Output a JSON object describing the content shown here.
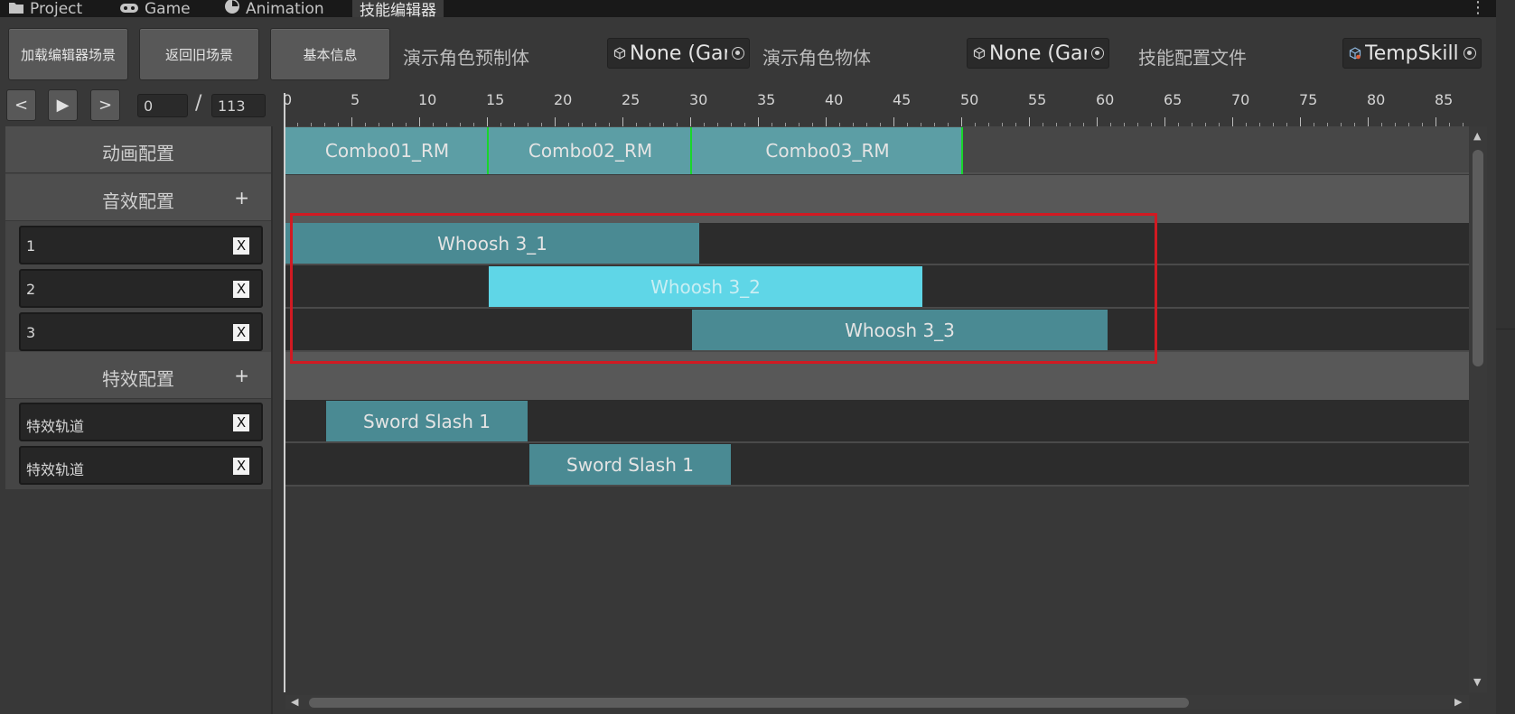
{
  "tabs": [
    {
      "label": "Project",
      "icon": "folder-icon"
    },
    {
      "label": "Game",
      "icon": "gamepad-icon"
    },
    {
      "label": "Animation",
      "icon": "clock-icon"
    },
    {
      "label": "技能编辑器",
      "active": true
    }
  ],
  "toolbar": {
    "load_scene_label": "加载编辑器场景",
    "back_scene_label": "返回旧场景",
    "basic_info_label": "基本信息",
    "preview_prefab_label": "演示角色预制体",
    "preview_prefab_value": "None (Gar",
    "preview_object_label": "演示角色物体",
    "preview_object_value": "None (Gar",
    "skill_config_label": "技能配置文件",
    "skill_config_value": "TempSkill"
  },
  "playback": {
    "prev_label": "<",
    "play_label": "▶",
    "next_label": ">",
    "current_frame": "0",
    "separator": "/",
    "total_frames": "113"
  },
  "ruler": {
    "labels": [
      "0",
      "5",
      "10",
      "15",
      "20",
      "25",
      "30",
      "35",
      "40",
      "45",
      "50",
      "55",
      "60",
      "65",
      "70",
      "75",
      "80",
      "85"
    ]
  },
  "left_panel": {
    "animation_header": "动画配置",
    "audio_header": "音效配置",
    "audio_add": "+",
    "audio_tracks": [
      {
        "name": "1",
        "remove": "X"
      },
      {
        "name": "2",
        "remove": "X"
      },
      {
        "name": "3",
        "remove": "X"
      }
    ],
    "effect_header": "特效配置",
    "effect_add": "+",
    "effect_tracks": [
      {
        "name": "特效轨道",
        "remove": "X"
      },
      {
        "name": "特效轨道",
        "remove": "X"
      }
    ]
  },
  "timeline": {
    "animation_clips": [
      {
        "name": "Combo01_RM",
        "start": 0,
        "end": 15
      },
      {
        "name": "Combo02_RM",
        "start": 15,
        "end": 30
      },
      {
        "name": "Combo03_RM",
        "start": 30,
        "end": 50
      }
    ],
    "audio_clips": [
      {
        "name": "Whoosh 3_1",
        "track": 1,
        "start": 0,
        "end": 30.6
      },
      {
        "name": "Whoosh 3_2",
        "track": 2,
        "start": 15,
        "end": 47,
        "selected": true
      },
      {
        "name": "Whoosh 3_3",
        "track": 3,
        "start": 30,
        "end": 60.7
      }
    ],
    "effect_clips": [
      {
        "name": "Sword Slash 1",
        "track": 1,
        "start": 3,
        "end": 18
      },
      {
        "name": "Sword Slash 1",
        "track": 2,
        "start": 18,
        "end": 33
      }
    ]
  },
  "colors": {
    "animation_clip": "#5c9ea5",
    "clip_boundary": "#19d62b",
    "audio_clip": "#4a8a93",
    "audio_clip_selected": "#5fd6e7",
    "highlight_box": "#d11a22"
  }
}
